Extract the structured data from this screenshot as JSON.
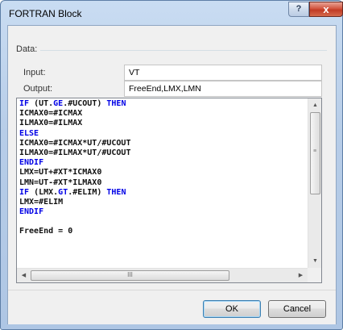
{
  "window": {
    "title": "FORTRAN Block",
    "help_label": "?",
    "close_label": "x"
  },
  "group": {
    "title": "Data:"
  },
  "fields": {
    "input_label": "Input:",
    "input_value": "VT",
    "output_label": "Output:",
    "output_value": "FreeEnd,LMX,LMN"
  },
  "editor": {
    "lines": [
      [
        "IF",
        " (UT.",
        "GE",
        ".#UCOUT) ",
        "THEN"
      ],
      [
        "ICMAX0=#ICMAX"
      ],
      [
        "ILMAX0=#ILMAX"
      ],
      [
        "ELSE"
      ],
      [
        "ICMAX0=#ICMAX*UT/#UCOUT"
      ],
      [
        "ILMAX0=#ILMAX*UT/#UCOUT"
      ],
      [
        "ENDIF"
      ],
      [
        "LMX=UT+#XT*ICMAX0"
      ],
      [
        "LMN=UT-#XT*ILMAX0"
      ],
      [
        "IF",
        " (LMX.",
        "GT",
        ".#ELIM) ",
        "THEN"
      ],
      [
        "LMX=#ELIM"
      ],
      [
        "ENDIF"
      ],
      [
        ""
      ],
      [
        "FreeEnd = 0"
      ]
    ],
    "hscroll_grip": "III"
  },
  "buttons": {
    "ok_label": "OK",
    "cancel_label": "Cancel"
  },
  "colors": {
    "keyword": "#0000e6",
    "close_button": "#c13b25",
    "window_frame": "#aec6e4"
  }
}
